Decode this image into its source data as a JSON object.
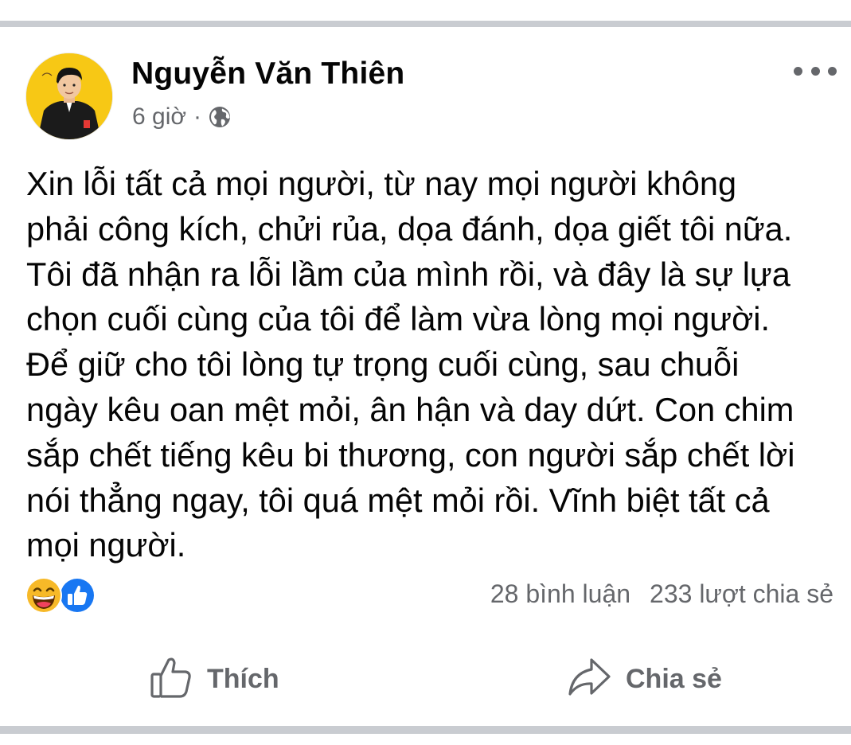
{
  "post": {
    "author": "Nguyễn Văn Thiên",
    "time": "6 giờ",
    "separator": "·",
    "privacy_icon": "globe-icon",
    "text": "Xin lỗi tất cả mọi người, từ nay mọi người không\nphải công kích, chửi rủa, dọa đánh, dọa giết tôi nữa.\nTôi đã nhận ra lỗi lầm của mình rồi, và đây là sự lựa\nchọn cuối cùng của tôi để làm vừa lòng mọi người.\nĐể giữ cho tôi lòng tự trọng cuối cùng, sau chuỗi\nngày kêu oan mệt mỏi, ân hận và day dứt. Con chim\nsắp chết tiếng kêu bi thương, con người sắp chết lời\nnói thẳng ngay, tôi quá mệt mỏi rồi. Vĩnh biệt tất cả\nmọi người."
  },
  "reactions": [
    "haha-reaction-icon",
    "like-reaction-icon"
  ],
  "stats": {
    "comments": "28 bình luận",
    "shares": "233 lượt chia sẻ"
  },
  "actions": {
    "like_label": "Thích",
    "share_label": "Chia sẻ"
  },
  "colors": {
    "text": "#050505",
    "secondary": "#65676b",
    "divider": "#c9ccd1",
    "avatar_bg": "#f7c815",
    "like_blue": "#1877f2",
    "haha_yellow": "#f7b928"
  }
}
